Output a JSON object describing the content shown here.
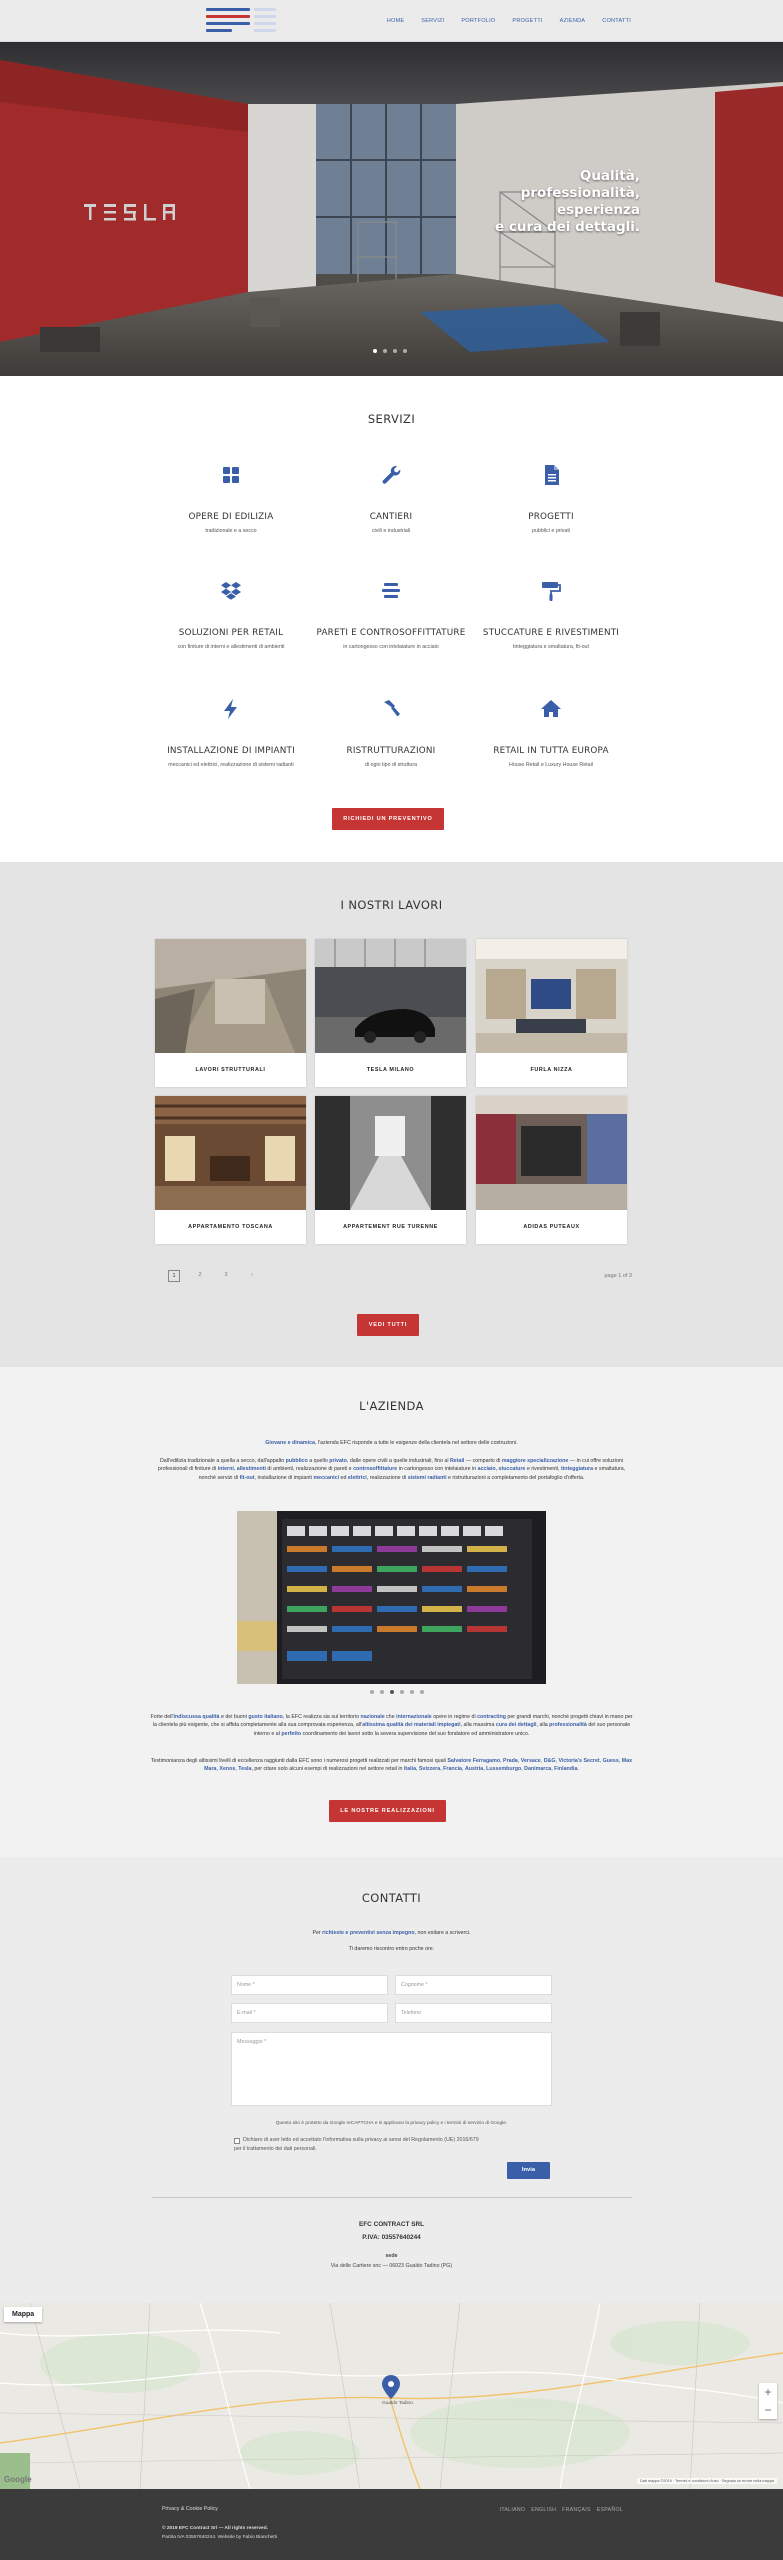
{
  "nav": {
    "items": [
      "HOME",
      "SERVIZI",
      "PORTFOLIO",
      "PROGETTI",
      "AZIENDA",
      "CONTATTI"
    ]
  },
  "colors": {
    "accent": "#3a5fa8",
    "brand_red": "#c53534",
    "dark": "#3b3b3b"
  },
  "hero": {
    "headline_lines": [
      "Qualità,",
      "professionalità,",
      "esperienza",
      "e cura dei dettagli."
    ],
    "wall_text": "TESLA",
    "slide_count": 4,
    "active_slide": 1
  },
  "servizi": {
    "title": "SERVIZI",
    "items": [
      {
        "icon": "grid-icon",
        "title": "OPERE DI EDILIZIA",
        "sub": "tradizionale e a secco"
      },
      {
        "icon": "wrench-icon",
        "title": "CANTIERI",
        "sub": "civili e industriali"
      },
      {
        "icon": "document-icon",
        "title": "PROGETTI",
        "sub": "pubblici e privati"
      },
      {
        "icon": "dropbox-icon",
        "title": "SOLUZIONI PER RETAIL",
        "sub": "con finiture di interni e allestimenti di ambienti"
      },
      {
        "icon": "layers-icon",
        "title": "PARETI E CONTROSOFFITTATURE",
        "sub": "in cartongesso con intelaiature in acciaio"
      },
      {
        "icon": "paint-roller-icon",
        "title": "STUCCATURE E RIVESTIMENTI",
        "sub": "tinteggiatura e smaltatura, fit-out"
      },
      {
        "icon": "lightning-icon",
        "title": "INSTALLAZIONE DI IMPIANTI",
        "sub": "meccanici ed elettrici, realizzazione di sistemi radianti"
      },
      {
        "icon": "hammer-icon",
        "title": "RISTRUTTURAZIONI",
        "sub": "di ogni tipo di struttura"
      },
      {
        "icon": "home-icon",
        "title": "RETAIL IN TUTTA EUROPA",
        "sub": "House Retail e Luxury House Retail"
      }
    ],
    "cta": "RICHIEDI UN PREVENTIVO"
  },
  "lavori": {
    "title": "I NOSTRI LAVORI",
    "items": [
      {
        "label": "LAVORI STRUTTURALI"
      },
      {
        "label": "TESLA MILANO"
      },
      {
        "label": "FURLA NIZZA"
      },
      {
        "label": "APPARTAMENTO TOSCANA"
      },
      {
        "label": "APPARTEMENT RUE TURENNE"
      },
      {
        "label": "ADIDAS PUTEAUX"
      }
    ],
    "pages": [
      "1",
      "2",
      "3",
      "›"
    ],
    "current_page": "1",
    "page_of": "page 1 of 3",
    "cta": "VEDI TUTTI"
  },
  "azienda": {
    "title": "L'AZIENDA",
    "p1_html": "<b>Giovane e dinamica</b>, l'azienda EFC risponde a tutte le esigenze della clientela nel settore delle costruzioni.",
    "p2_html": "Dall'edilizia tradizionale a quella a secco, dall'appalto <b>pubblico</b> a quello <b>privato</b>, dalle opere civili a quelle industriali, fino al <b>Retail</b> — comparto di <b>maggiore specializzazione</b> — in cui offre soluzioni professionali di finiture di <b>interni</b>, <b>allestimenti</b> di ambienti, realizzazione di pareti e <b>controsoffittature</b> in cartongesso con intelaiature in <b>acciaio</b>, <b>stuccature</b> e rivestimenti, <b>tinteggiatura</b> e smaltatura, nonché servizi di <b>fit-out</b>, installazione di impianti <b>meccanici</b> ed <b>elettrici</b>, realizzazione di <b>sistemi radianti</b> e ristrutturazioni a completamento del portafoglio d'offerta.",
    "slide_count": 6,
    "active_slide": 3,
    "p3_html": "Forte dell'<b>indiscussa qualità</b> e dei buoni <b>gusto italiano</b>, la EFC realizza sia sul territorio <b>nazionale</b> che <b>internazionale</b> opere in regime di <b>contracting</b> per grandi marchi, nonché progetti chiavi in mano per la clientela più esigente, che si affida completamente alla sua comprovata esperienza, all'<b>altissima qualità dei materiali impiegati</b>, alla massima <b>cura dei dettagli</b>, alla <b>professionalità</b> del suo personale interno e al <b>perfetto</b> coordinamento dei lavori sotto la severa supervisione del suo fondatore ed amministratore unico.",
    "p4_html": "Testimonianza degli altissimi livelli di eccellenza raggiunti dalla EFC sono i numerosi progetti realizzati per marchi famosi quali <b>Salvatore Ferragamo</b>, <b>Prada</b>, <b>Versace</b>, <b>D&G</b>, <b>Victoria's Secret</b>, <b>Guess</b>, <b>Max Mara</b>, <b>Xenos</b>, <b>Tesla</b>, per citare solo alcuni esempi di realizzazioni nel settore retail in <b>Italia</b>, <b>Svizzera</b>, <b>Francia</b>, <b>Austria</b>, <b>Lussemburgo</b>, <b>Danimarca</b>, <b>Finlandia</b>.",
    "cta": "LE NOSTRE REALIZZAZIONI"
  },
  "contatti": {
    "title": "CONTATTI",
    "intro_html": "Per <b>richieste e preventivi senza impegno</b>, non esitare a scriverci.",
    "intro2": "Ti daremo riscontro entro poche ore.",
    "placeholders": {
      "nome": "Nome *",
      "cognome": "Cognome *",
      "email": "E-mail *",
      "telefono": "Telefono",
      "messaggio": "Messaggio *"
    },
    "recaptcha_note": "Questo sito è protetto da Google reCAPTCHA e si applicano la privacy policy e i termini di servizio di Google.",
    "consent_line1": "Dichiaro di aver letto ed accettato l'informativa sulla privacy ai sensi del Regolamento (UE) 2016/679",
    "consent_line2": "per il trattamento dei dati personali.",
    "submit": "Invia",
    "company": "EFC CONTRACT SRL",
    "piva": "P.IVA: 03557640244",
    "sede_label": "sede",
    "address": "Via delle Cartiere snc — 06023 Gualdo Tadino (PG)"
  },
  "map": {
    "tab": "Mappa",
    "pin_label": "Gualdo Tadino",
    "zoom_in": "+",
    "zoom_out": "−",
    "brand": "Google",
    "attribution": "Dati mappa ©2019  ·  Termini e condizioni d'uso  ·  Segnala un errore nella mappa"
  },
  "footer": {
    "privacy": "Privacy & Cookie Policy",
    "copyright": "© 2019 EFC Contract Srl — All rights reserved.",
    "credits": "Partita IVA 03557640244. Website by Fabio Bianchetti",
    "languages": [
      "ITALIANO",
      "ENGLISH",
      "FRANÇAIS",
      "ESPAÑOL"
    ]
  }
}
